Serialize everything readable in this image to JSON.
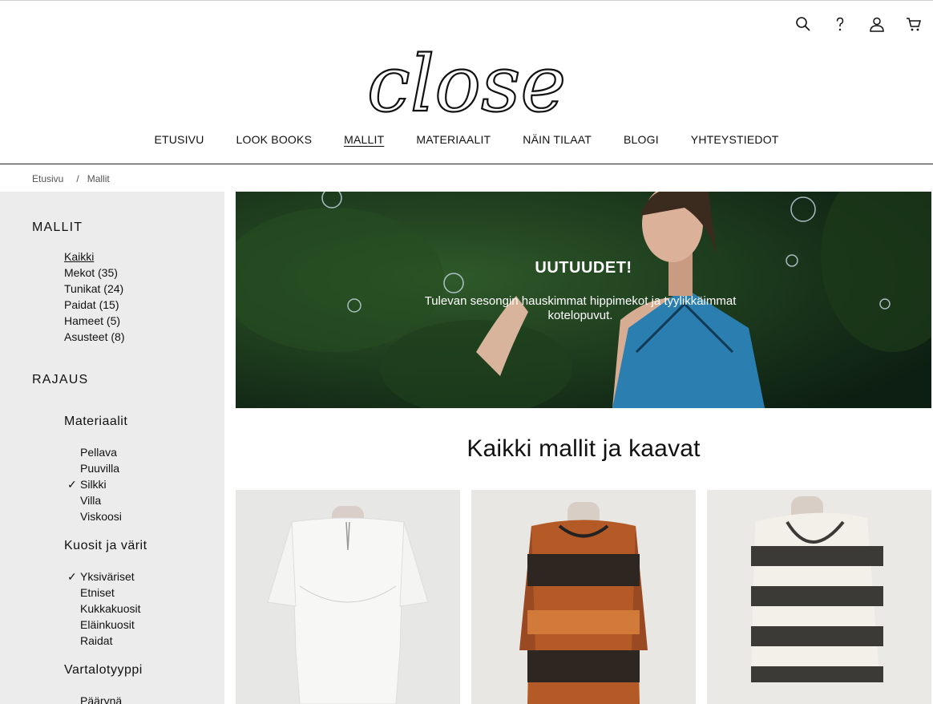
{
  "header": {
    "logo": "close",
    "icons": [
      "search-icon",
      "help-icon",
      "account-icon",
      "cart-icon"
    ]
  },
  "nav": {
    "items": [
      "ETUSIVU",
      "LOOK BOOKS",
      "MALLIT",
      "MATERIAALIT",
      "NÄIN TILAAT",
      "BLOGI",
      "YHTEYSTIEDOT"
    ],
    "active": "MALLIT"
  },
  "breadcrumb": [
    "Etusivu",
    "/",
    "Mallit"
  ],
  "sidebar": {
    "mallit_title": "MALLIT",
    "mallit_items": [
      "Kaikki",
      "Mekot (35)",
      "Tunikat (24)",
      "Paidat (15)",
      "Hameet (5)",
      "Asusteet (8)"
    ],
    "rajaus_title": "RAJAUS",
    "materiaalit_title": "Materiaalit",
    "materiaalit_items": [
      "Pellava",
      "Puuvilla",
      "Silkki",
      "Villa",
      "Viskoosi"
    ],
    "kuosit_title": "Kuosit ja värit",
    "kuosit_items": [
      "Yksiväriset",
      "Etniset",
      "Kukkakuosit",
      "Eläinkuosit",
      "Raidat"
    ],
    "vartalo_title": "Vartalotyyppi",
    "vartalo_items": [
      "Päärynä"
    ],
    "checkmark": "✓"
  },
  "hero": {
    "title": "UUTUUDET!",
    "subtitle": "Tulevan sesongin hauskimmat hippimekot ja tyylikkäimmat kotelopuvut."
  },
  "main": {
    "heading": "Kaikki mallit ja kaavat"
  },
  "colors": {
    "sidebar_bg": "#ececec",
    "hero_bg": "#163020",
    "dress_blue": "#2a7fb0"
  }
}
